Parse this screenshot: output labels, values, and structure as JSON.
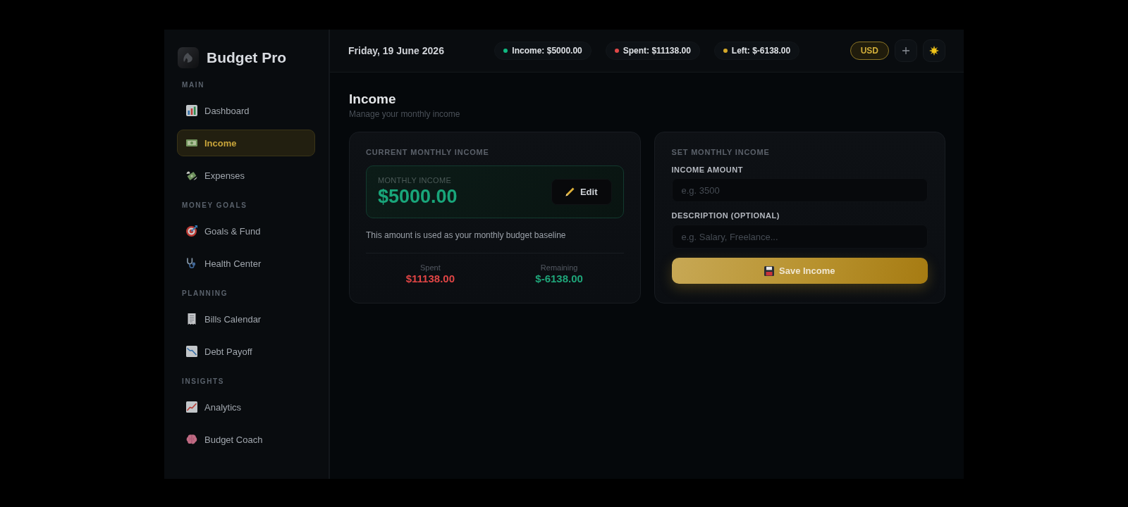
{
  "app": {
    "name": "Budget Pro"
  },
  "sidebar": {
    "sections": [
      {
        "heading": "MAIN",
        "items": [
          {
            "label": "Dashboard",
            "selected": false
          },
          {
            "label": "Income",
            "selected": true
          },
          {
            "label": "Expenses",
            "selected": false
          }
        ]
      },
      {
        "heading": "MONEY GOALS",
        "items": [
          {
            "label": "Goals & Fund",
            "selected": false
          },
          {
            "label": "Health Center",
            "selected": false
          }
        ]
      },
      {
        "heading": "PLANNING",
        "items": [
          {
            "label": "Bills Calendar",
            "selected": false
          },
          {
            "label": "Debt Payoff",
            "selected": false
          }
        ]
      },
      {
        "heading": "INSIGHTS",
        "items": [
          {
            "label": "Analytics",
            "selected": false
          },
          {
            "label": "Budget Coach",
            "selected": false
          }
        ]
      }
    ]
  },
  "topbar": {
    "date": "Friday, 19 June 2026",
    "summary": [
      {
        "label": "Income: $5000.00",
        "color": "#10b981"
      },
      {
        "label": "Spent: $11138.00",
        "color": "#e04848"
      },
      {
        "label": "Left: $-6138.00",
        "color": "#d4a82a"
      }
    ],
    "currency_button": "USD"
  },
  "page": {
    "title": "Income",
    "subtitle": "Manage your monthly income"
  },
  "current_card": {
    "heading": "CURRENT MONTHLY INCOME",
    "amount_label": "MONTHLY INCOME",
    "amount": "$5000.00",
    "edit_button": "Edit",
    "note": "This amount is used as your monthly budget baseline",
    "stats": [
      {
        "label": "Spent",
        "value": "$11138.00",
        "color": "#e04545"
      },
      {
        "label": "Remaining",
        "value": "$-6138.00",
        "color": "#1fa67a"
      }
    ]
  },
  "form_card": {
    "heading": "SET MONTHLY INCOME",
    "fields": [
      {
        "label": "INCOME AMOUNT",
        "placeholder": "e.g. 3500"
      },
      {
        "label": "DESCRIPTION (OPTIONAL)",
        "placeholder": "e.g. Salary, Freelance..."
      }
    ],
    "save_button": "Save Income"
  }
}
